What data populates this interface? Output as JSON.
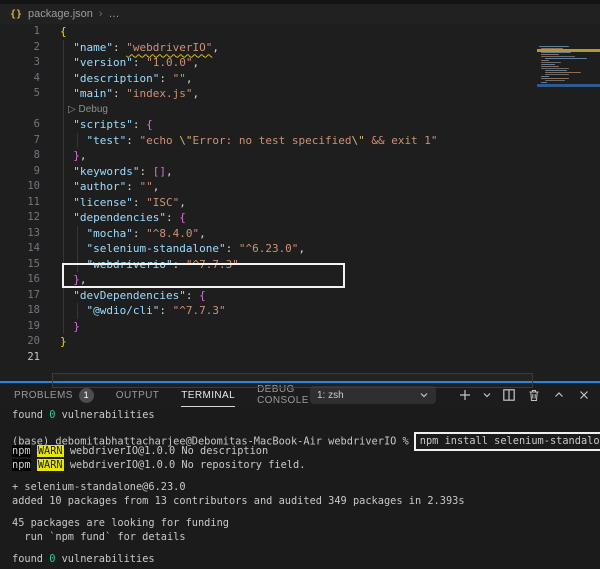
{
  "colors": {
    "accent_blue": "#1f87e0",
    "warn_yellow": "#e5e510",
    "ok_green": "#23d18b",
    "json_key": "#9cdcfe",
    "json_string": "#ce9178",
    "bracket_gold": "#ffd700",
    "bracket_pink": "#da70d6",
    "annotation_box": "#f2f2f2"
  },
  "breadcrumb": {
    "icon_text": "{}",
    "file_label": "package.json",
    "separator": "›",
    "ellipsis": "…"
  },
  "editor": {
    "codelens_label": "Debug",
    "lines": [
      {
        "n": "1",
        "guides": [],
        "seg": [
          [
            "b1",
            "{"
          ]
        ]
      },
      {
        "n": "2",
        "guides": [
          1
        ],
        "seg": [
          [
            "ws",
            "  "
          ],
          [
            "key",
            "\"name\""
          ],
          [
            "punc",
            ": "
          ],
          [
            "strwavy",
            "\"webdriverIO\""
          ],
          [
            "punc",
            ","
          ]
        ]
      },
      {
        "n": "3",
        "guides": [
          1
        ],
        "seg": [
          [
            "ws",
            "  "
          ],
          [
            "key",
            "\"version\""
          ],
          [
            "punc",
            ": "
          ],
          [
            "str",
            "\"1.0.0\""
          ],
          [
            "punc",
            ","
          ]
        ]
      },
      {
        "n": "4",
        "guides": [
          1
        ],
        "seg": [
          [
            "ws",
            "  "
          ],
          [
            "key",
            "\"description\""
          ],
          [
            "punc",
            ": "
          ],
          [
            "str",
            "\"\""
          ],
          [
            "punc",
            ","
          ]
        ]
      },
      {
        "n": "5",
        "guides": [
          1
        ],
        "seg": [
          [
            "ws",
            "  "
          ],
          [
            "key",
            "\"main\""
          ],
          [
            "punc",
            ": "
          ],
          [
            "str",
            "\"index.js\""
          ],
          [
            "punc",
            ","
          ]
        ]
      },
      {
        "n": "",
        "guides": [
          1
        ],
        "lens": true,
        "seg": [
          [
            "lensplay",
            "▷ "
          ],
          [
            "lens",
            "Debug"
          ]
        ]
      },
      {
        "n": "6",
        "guides": [
          1
        ],
        "seg": [
          [
            "ws",
            "  "
          ],
          [
            "key",
            "\"scripts\""
          ],
          [
            "punc",
            ": "
          ],
          [
            "b2",
            "{"
          ]
        ]
      },
      {
        "n": "7",
        "guides": [
          1,
          2
        ],
        "seg": [
          [
            "ws",
            "    "
          ],
          [
            "key",
            "\"test\""
          ],
          [
            "punc",
            ": "
          ],
          [
            "str",
            "\"echo "
          ],
          [
            "esc",
            "\\\""
          ],
          [
            "str",
            "Error: no test specified"
          ],
          [
            "esc",
            "\\\""
          ],
          [
            "str",
            " && exit 1\""
          ]
        ]
      },
      {
        "n": "8",
        "guides": [
          1
        ],
        "seg": [
          [
            "ws",
            "  "
          ],
          [
            "b2",
            "}"
          ],
          [
            "punc",
            ","
          ]
        ]
      },
      {
        "n": "9",
        "guides": [
          1
        ],
        "seg": [
          [
            "ws",
            "  "
          ],
          [
            "key",
            "\"keywords\""
          ],
          [
            "punc",
            ": "
          ],
          [
            "b2",
            "[]"
          ],
          [
            "punc",
            ","
          ]
        ]
      },
      {
        "n": "10",
        "guides": [
          1
        ],
        "seg": [
          [
            "ws",
            "  "
          ],
          [
            "key",
            "\"author\""
          ],
          [
            "punc",
            ": "
          ],
          [
            "str",
            "\"\""
          ],
          [
            "punc",
            ","
          ]
        ]
      },
      {
        "n": "11",
        "guides": [
          1
        ],
        "seg": [
          [
            "ws",
            "  "
          ],
          [
            "key",
            "\"license\""
          ],
          [
            "punc",
            ": "
          ],
          [
            "str",
            "\"ISC\""
          ],
          [
            "punc",
            ","
          ]
        ]
      },
      {
        "n": "12",
        "guides": [
          1
        ],
        "seg": [
          [
            "ws",
            "  "
          ],
          [
            "key",
            "\"dependencies\""
          ],
          [
            "punc",
            ": "
          ],
          [
            "b2",
            "{"
          ]
        ]
      },
      {
        "n": "13",
        "guides": [
          1,
          2
        ],
        "seg": [
          [
            "ws",
            "    "
          ],
          [
            "key",
            "\"mocha\""
          ],
          [
            "punc",
            ": "
          ],
          [
            "str",
            "\"^8.4.0\""
          ],
          [
            "punc",
            ","
          ]
        ]
      },
      {
        "n": "14",
        "guides": [
          1,
          2
        ],
        "seg": [
          [
            "ws",
            "    "
          ],
          [
            "key",
            "\"selenium-standalone\""
          ],
          [
            "punc",
            ": "
          ],
          [
            "str",
            "\"^6.23.0\""
          ],
          [
            "punc",
            ","
          ]
        ]
      },
      {
        "n": "15",
        "guides": [
          1,
          2
        ],
        "seg": [
          [
            "ws",
            "    "
          ],
          [
            "key",
            "\"webdriverio\""
          ],
          [
            "punc",
            ": "
          ],
          [
            "str",
            "\"^7.7.3\""
          ]
        ]
      },
      {
        "n": "16",
        "guides": [
          1
        ],
        "seg": [
          [
            "ws",
            "  "
          ],
          [
            "b2",
            "}"
          ],
          [
            "punc",
            ","
          ]
        ]
      },
      {
        "n": "17",
        "guides": [
          1
        ],
        "seg": [
          [
            "ws",
            "  "
          ],
          [
            "key",
            "\"devDependencies\""
          ],
          [
            "punc",
            ": "
          ],
          [
            "b2",
            "{"
          ]
        ]
      },
      {
        "n": "18",
        "guides": [
          1,
          2
        ],
        "seg": [
          [
            "ws",
            "    "
          ],
          [
            "key",
            "\"@wdio/cli\""
          ],
          [
            "punc",
            ": "
          ],
          [
            "str",
            "\"^7.7.3\""
          ]
        ]
      },
      {
        "n": "19",
        "guides": [
          1
        ],
        "seg": [
          [
            "ws",
            "  "
          ],
          [
            "b2",
            "}"
          ]
        ]
      },
      {
        "n": "20",
        "guides": [],
        "seg": [
          [
            "b1",
            "}"
          ]
        ]
      },
      {
        "n": "21",
        "guides": [],
        "active": true,
        "seg": []
      }
    ]
  },
  "panel": {
    "tabs": [
      {
        "label": "PROBLEMS",
        "badge": "1"
      },
      {
        "label": "OUTPUT"
      },
      {
        "label": "TERMINAL",
        "active": true
      },
      {
        "label": "DEBUG CONSOLE"
      }
    ],
    "terminal_select": "1: zsh"
  },
  "terminal": {
    "lines": [
      {
        "seg": [
          [
            "t",
            "found "
          ],
          [
            "g",
            "0"
          ],
          [
            "t",
            " vulnerabilities"
          ]
        ]
      },
      {
        "blank": true
      },
      {
        "seg": [
          [
            "t",
            "(base) debomitabhattacharjee@Debomitas-MacBook-Air webdriverIO %"
          ],
          [
            "cmd",
            "npm install selenium-standalone"
          ]
        ]
      },
      {
        "seg": [
          [
            "npmtag",
            "npm"
          ],
          [
            "t",
            " "
          ],
          [
            "warntag",
            "WARN"
          ],
          [
            "t",
            " webdriverIO@1.0.0 No description"
          ]
        ]
      },
      {
        "seg": [
          [
            "npmtag",
            "npm"
          ],
          [
            "t",
            " "
          ],
          [
            "warntag",
            "WARN"
          ],
          [
            "t",
            " webdriverIO@1.0.0 No repository field."
          ]
        ]
      },
      {
        "blank": true
      },
      {
        "seg": [
          [
            "t",
            "+ selenium-standalone@6.23.0"
          ]
        ]
      },
      {
        "seg": [
          [
            "t",
            "added 10 packages from 13 contributors and audited 349 packages in 2.393s"
          ]
        ]
      },
      {
        "blank": true
      },
      {
        "seg": [
          [
            "t",
            "45 packages are looking for funding"
          ]
        ]
      },
      {
        "seg": [
          [
            "t",
            "  run `npm fund` for details"
          ]
        ]
      },
      {
        "blank": true
      },
      {
        "seg": [
          [
            "t",
            "found "
          ],
          [
            "g",
            "0"
          ],
          [
            "t",
            " vulnerabilities"
          ]
        ]
      }
    ]
  }
}
